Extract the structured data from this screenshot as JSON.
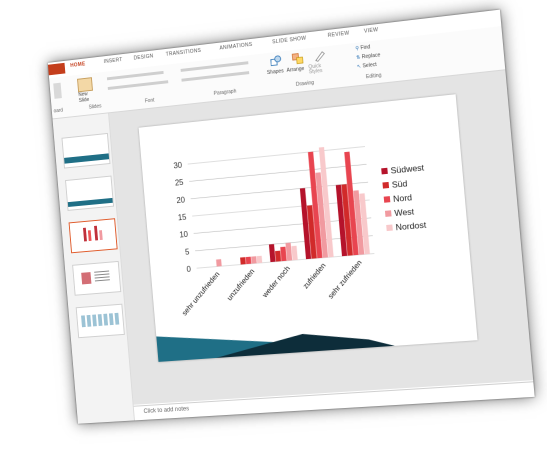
{
  "ribbon": {
    "tabs": [
      "HOME",
      "INSERT",
      "DESIGN",
      "TRANSITIONS",
      "ANIMATIONS",
      "SLIDE SHOW",
      "REVIEW",
      "VIEW"
    ],
    "active_tab": "HOME",
    "groups": {
      "clipboard": "oard",
      "slides": "Slides",
      "font": "Font",
      "paragraph": "Paragraph",
      "drawing": "Drawing",
      "editing": "Editing"
    },
    "new_slide": "New Slide",
    "shapes": "Shapes",
    "arrange": "Arrange",
    "quick_styles": "Quick Styles",
    "find": "Find",
    "replace": "Replace",
    "select": "Select"
  },
  "notes_placeholder": "Click to add notes",
  "colors": {
    "accent": "#c43e1c",
    "teal": "#1f6f86"
  },
  "chart_data": {
    "type": "bar",
    "categories": [
      "sehr unzufrieden",
      "unzufrieden",
      "weder noch",
      "zufrieden",
      "sehr zufrieden"
    ],
    "series": [
      {
        "name": "Südwest",
        "values": [
          0,
          0,
          5,
          20,
          20
        ],
        "color": "#b5132b"
      },
      {
        "name": "Süd",
        "values": [
          0,
          2,
          3,
          15,
          20
        ],
        "color": "#d12a2a"
      },
      {
        "name": "Nord",
        "values": [
          0,
          2,
          4,
          30,
          29
        ],
        "color": "#e84550"
      },
      {
        "name": "West",
        "values": [
          2,
          2,
          5,
          24,
          18
        ],
        "color": "#f19aa0"
      },
      {
        "name": "Nordost",
        "values": [
          0,
          2,
          4,
          31,
          17
        ],
        "color": "#f8c9cb"
      }
    ],
    "ylim": [
      0,
      30
    ],
    "yticks": [
      0,
      5,
      10,
      15,
      20,
      25,
      30
    ],
    "grid": true,
    "legend": "right"
  }
}
